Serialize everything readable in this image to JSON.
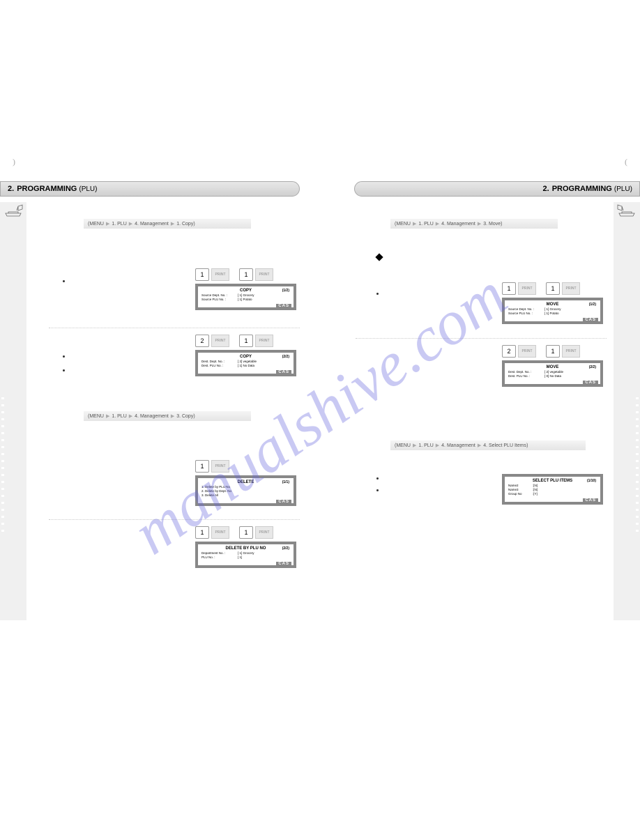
{
  "watermark": "manualshive.com",
  "header": {
    "num": "2.",
    "title": "PROGRAMMING",
    "sub": "(PLU)"
  },
  "breadcrumbs": {
    "bc1": {
      "s1": "MENU",
      "s2": "1. PLU",
      "s3": "4. Management",
      "s4": "1. Copy"
    },
    "bc2": {
      "s1": "MENU",
      "s2": "1. PLU",
      "s3": "4. Management",
      "s4": "3. Copy"
    },
    "bc3": {
      "s1": "MENU",
      "s2": "1. PLU",
      "s3": "4. Management",
      "s4": "3. Move"
    },
    "bc4": {
      "s1": "MENU",
      "s2": "1. PLU",
      "s3": "4. Management",
      "s4": "4. Select PLU Items"
    }
  },
  "keys": {
    "k1": "1",
    "k2": "2",
    "print": "PRINT"
  },
  "lcd": {
    "copy1": {
      "title": "COPY",
      "page": "(1/2)",
      "l1a": "Source Dept. No. :",
      "l1b": "[   1] Grocery",
      "l2a": "Source PLU No. :",
      "l2b": "[   1] Potato"
    },
    "copy2": {
      "title": "COPY",
      "page": "(2/2)",
      "l1a": "Dest. Dept. No. :",
      "l1b": "[   2] vegetable",
      "l2a": "Dest. PLU No. :",
      "l2b": "[   1] No Data"
    },
    "delete1": {
      "title": "DELETE",
      "page": "(1/1)",
      "l1": "1. Delete by PLU No",
      "l2": "2. Delete by Dept. No",
      "l3": "3. Delete All"
    },
    "delete2": {
      "title": "DELETE BY PLU NO",
      "page": "(2/2)",
      "l1a": "Department No. :",
      "l1b": "[   1] Grocery",
      "l2a": "PLU No. :",
      "l2b": "[   1]"
    },
    "move1": {
      "title": "MOVE",
      "page": "(1/2)",
      "l1a": "Source Dept. No. :",
      "l1b": "[   1] Grocery",
      "l2a": "Source PLU No. :",
      "l2b": "[   1] Potato"
    },
    "move2": {
      "title": "MOVE",
      "page": "(2/2)",
      "l1a": "Dest. Dept. No. :",
      "l1b": "[   2] vegetable",
      "l2a": "Dest. PLU No. :",
      "l2b": "[   0] No Data"
    },
    "select": {
      "title": "SELECT PLU ITEMS",
      "page": "(1/10)",
      "l1a": "Name2",
      "l1b": ":[N]",
      "l2a": "Name3",
      "l2b": ":[N]",
      "l3a": "Group No",
      "l3b": ":[Y]"
    },
    "brand": "CAS"
  },
  "pagenum": {
    "left": ")",
    "right": "("
  }
}
